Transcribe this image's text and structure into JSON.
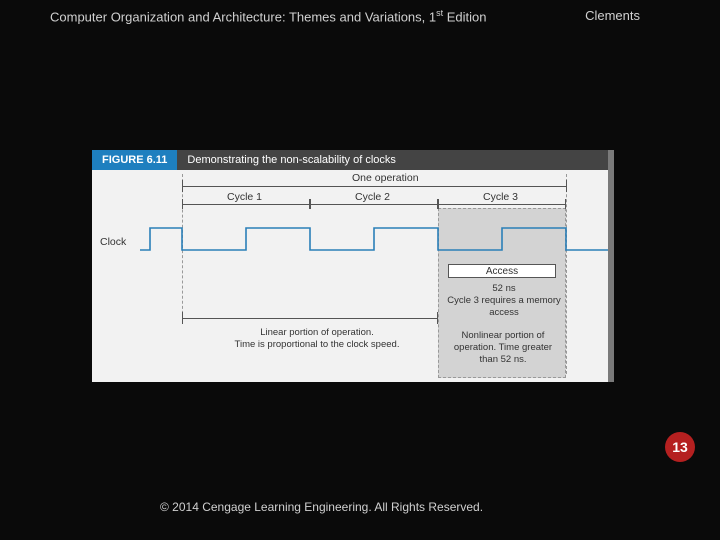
{
  "header": {
    "title_pre": "Computer Organization and Architecture: Themes and Variations, 1",
    "title_sup": "st",
    "title_post": " Edition",
    "author": "Clements"
  },
  "figure": {
    "tag": "FIGURE 6.11",
    "caption": "Demonstrating the non-scalability of clocks",
    "one_operation": "One operation",
    "cycle1": "Cycle 1",
    "cycle2": "Cycle 2",
    "cycle3": "Cycle 3",
    "clock": "Clock",
    "access": "Access",
    "note_52": "52 ns\nCycle 3 requires a memory access",
    "linear": "Linear portion of operation.\nTime is proportional to the clock speed.",
    "nonlinear": "Nonlinear portion of operation. Time greater than 52 ns."
  },
  "page": "13",
  "copyright": "© 2014 Cengage Learning Engineering. All Rights Reserved."
}
